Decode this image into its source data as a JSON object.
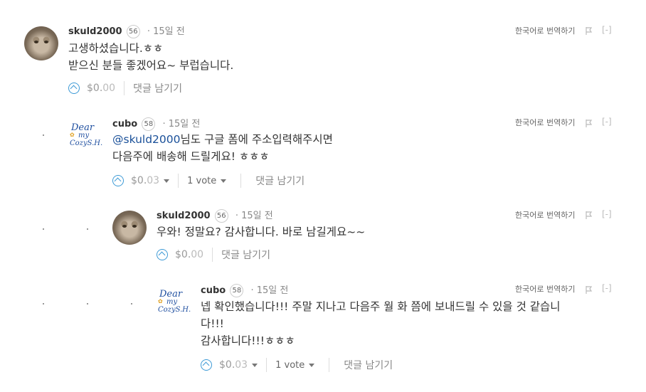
{
  "comments": [
    {
      "author": "skuld2000",
      "rep": "56",
      "time": "· 15일 전",
      "translate": "한국어로 번역하기",
      "collapse": "[-]",
      "lines": [
        "고생하셨습니다.ㅎㅎ",
        "받으신 분들 좋겠어요~ 부럽습니다."
      ],
      "payout_main": "$0.",
      "payout_cents": "00",
      "reply": "댓글 남기기",
      "avatar": "cat-avatar"
    },
    {
      "author": "cubo",
      "rep": "58",
      "time": "· 15일 전",
      "translate": "한국어로 번역하기",
      "collapse": "[-]",
      "mention": "@skuld2000",
      "line1_rest": "님도 구글 폼에 주소입력해주시면",
      "line2": "다음주에 배송해 드릴게요! ㅎㅎㅎ",
      "payout_main": "$0.",
      "payout_cents": "03",
      "votes": "1 vote",
      "reply": "댓글 남기기",
      "avatar": "dear-my-cozy-logo"
    },
    {
      "author": "skuld2000",
      "rep": "56",
      "time": "· 15일 전",
      "translate": "한국어로 번역하기",
      "collapse": "[-]",
      "lines": [
        "우와! 정말요? 감사합니다. 바로 남길게요~~"
      ],
      "payout_main": "$0.",
      "payout_cents": "00",
      "reply": "댓글 남기기",
      "avatar": "cat-avatar"
    },
    {
      "author": "cubo",
      "rep": "58",
      "time": "· 15일 전",
      "translate": "한국어로 번역하기",
      "collapse": "[-]",
      "lines": [
        "넵 확인했습니다!!! 주말 지나고 다음주 월 화 쯤에 보내드릴 수 있을 것 같습니",
        "다!!!",
        "감사합니다!!!ㅎㅎㅎ"
      ],
      "payout_main": "$0.",
      "payout_cents": "03",
      "votes": "1 vote",
      "reply": "댓글 남기기",
      "avatar": "dear-my-cozy-logo"
    }
  ],
  "colors": {
    "accent": "#3d9ad6",
    "mention": "#1a5099"
  }
}
